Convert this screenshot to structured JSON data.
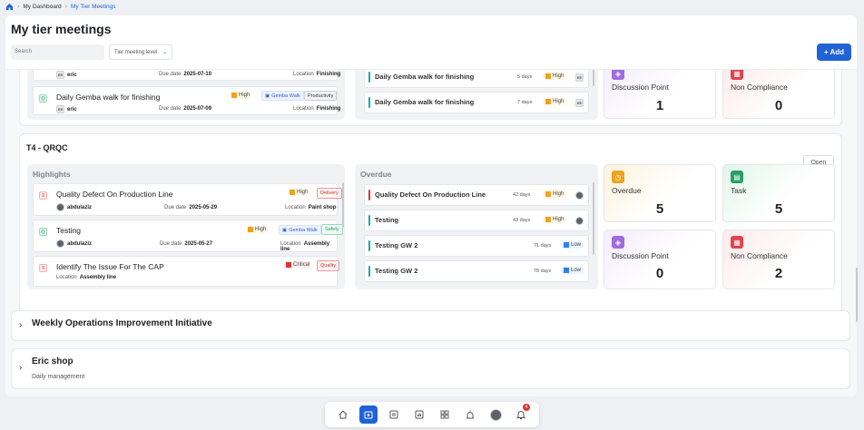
{
  "breadcrumb": {
    "home_icon": "home-icon",
    "items": [
      "My Dashboard",
      "My Tier Meetings"
    ]
  },
  "header": {
    "title": "My tier meetings",
    "search_placeholder": "Search",
    "tier_filter": "Tier meeting level",
    "add_label": "+ Add"
  },
  "colors": {
    "accent": "#1f63d6",
    "high": "#f0a21a",
    "low": "#2f80ed",
    "critical": "#e0342f"
  },
  "top_group": {
    "highlights": [
      {
        "user": "eric",
        "due_label": "Due date",
        "due": "2025-07-10",
        "location_label": "Location",
        "location": "Finishing"
      },
      {
        "title": "Daily Gemba walk for finishing",
        "priority": "High",
        "tag1": "Gemba Walk",
        "tag2": "Productivity",
        "user": "eric",
        "due_label": "Due date",
        "due": "2025-07-09",
        "location_label": "Location",
        "location": "Finishing"
      }
    ],
    "overdue": [
      {
        "title": "Daily Gemba walk for finishing",
        "days": "5 days",
        "priority": "High",
        "avatar": "EE"
      },
      {
        "title": "Daily Gemba walk for finishing",
        "days": "7 days",
        "priority": "High",
        "avatar": "EE"
      }
    ],
    "stats": [
      {
        "label": "Discussion Point",
        "value": "1"
      },
      {
        "label": "Non Compliance",
        "value": "0"
      }
    ]
  },
  "t4": {
    "title": "T4 - QRQC",
    "open_label": "Open",
    "highlights_title": "Highlights",
    "overdue_title": "Overdue",
    "highlights": [
      {
        "title": "Quality Defect On Production Line",
        "priority": "High",
        "tag": "Delivery",
        "user": "abdulaziz",
        "due_label": "Due date",
        "due": "2025-05-29",
        "location_label": "Location",
        "location": "Paint shop"
      },
      {
        "title": "Testing",
        "priority": "High",
        "tag1": "Gemba Walk",
        "tag2": "Safety",
        "user": "abdulaziz",
        "due_label": "Due date",
        "due": "2025-05-27",
        "location_label": "Location",
        "location": "Assembly line"
      },
      {
        "title": "Identify The Issue For The CAP",
        "priority": "Critical",
        "tag": "Quality",
        "location_label": "Location",
        "location": "Assembly line"
      }
    ],
    "overdue": [
      {
        "title": "Quality Defect On Production Line",
        "days": "42 days",
        "priority": "High"
      },
      {
        "title": "Testing",
        "days": "43 days",
        "priority": "High"
      },
      {
        "title": "Testing GW 2",
        "days": "71 days",
        "priority": "Low"
      },
      {
        "title": "Testing GW 2",
        "days": "78 days",
        "priority": "Low"
      }
    ],
    "stats": [
      {
        "label": "Overdue",
        "value": "5"
      },
      {
        "label": "Task",
        "value": "5"
      },
      {
        "label": "Discussion Point",
        "value": "0"
      },
      {
        "label": "Non Compliance",
        "value": "2"
      }
    ]
  },
  "groups": [
    {
      "title": "Weekly Operations Improvement Initiative"
    },
    {
      "title": "Eric shop",
      "subtitle": "Daily management"
    }
  ],
  "dock": {
    "items": [
      "home-icon",
      "meetings-icon",
      "board-icon",
      "chart-icon",
      "apps-icon",
      "alarm-icon",
      "profile-avatar",
      "bell-icon"
    ],
    "notification_count": "4"
  }
}
